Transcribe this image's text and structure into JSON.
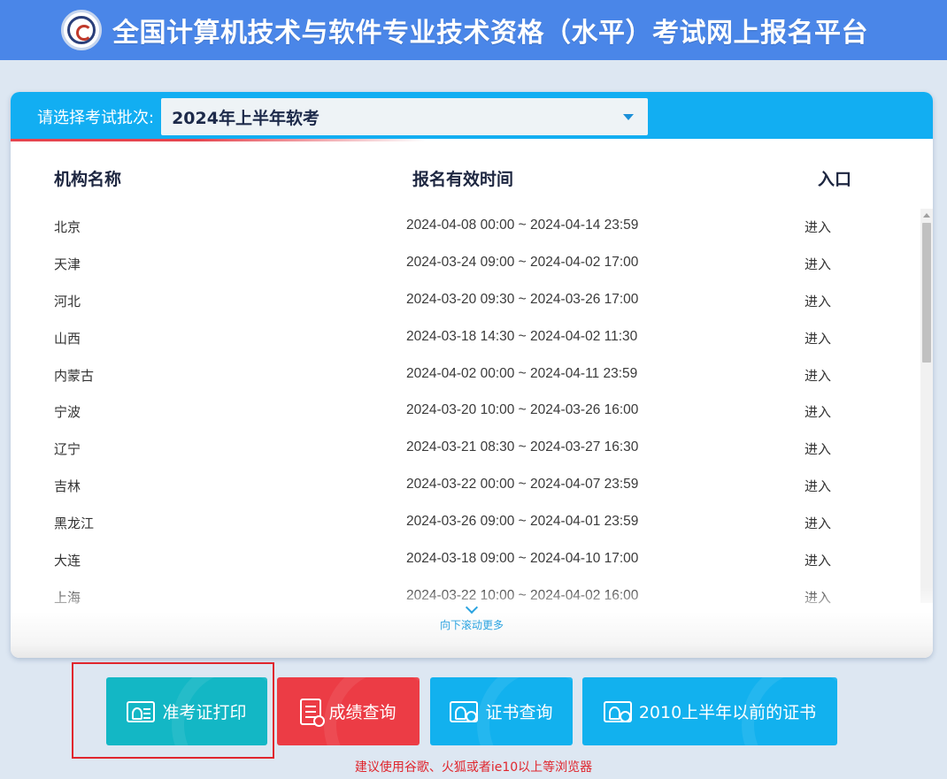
{
  "header": {
    "title": "全国计算机技术与软件专业技术资格（水平）考试网上报名平台"
  },
  "batch": {
    "label": "请选择考试批次:",
    "selected": "2024年上半年软考"
  },
  "table": {
    "columns": [
      "机构名称",
      "报名有效时间",
      "入口"
    ],
    "rows": [
      {
        "org": "北京",
        "time": "2024-04-08 00:00 ~ 2024-04-14 23:59",
        "entry": "进入"
      },
      {
        "org": "天津",
        "time": "2024-03-24 09:00 ~ 2024-04-02 17:00",
        "entry": "进入"
      },
      {
        "org": "河北",
        "time": "2024-03-20 09:30 ~ 2024-03-26 17:00",
        "entry": "进入"
      },
      {
        "org": "山西",
        "time": "2024-03-18 14:30 ~ 2024-04-02 11:30",
        "entry": "进入"
      },
      {
        "org": "内蒙古",
        "time": "2024-04-02 00:00 ~ 2024-04-11 23:59",
        "entry": "进入"
      },
      {
        "org": "宁波",
        "time": "2024-03-20 10:00 ~ 2024-03-26 16:00",
        "entry": "进入"
      },
      {
        "org": "辽宁",
        "time": "2024-03-21 08:30 ~ 2024-03-27 16:30",
        "entry": "进入"
      },
      {
        "org": "吉林",
        "time": "2024-03-22 00:00 ~ 2024-04-07 23:59",
        "entry": "进入"
      },
      {
        "org": "黑龙江",
        "time": "2024-03-26 09:00 ~ 2024-04-01 23:59",
        "entry": "进入"
      },
      {
        "org": "大连",
        "time": "2024-03-18 09:00 ~ 2024-04-10 17:00",
        "entry": "进入"
      },
      {
        "org": "上海",
        "time": "2024-03-22 10:00 ~ 2024-04-02 16:00",
        "entry": "进入"
      }
    ],
    "scroll_more": "向下滚动更多"
  },
  "actions": {
    "ticket_print": "准考证打印",
    "score_query": "成绩查询",
    "cert_query": "证书查询",
    "old_cert": "2010上半年以前的证书"
  },
  "note": "建议使用谷歌、火狐或者ie10以上等浏览器",
  "colors": {
    "header": "#4a86e8",
    "panel_head": "#12aef2",
    "ticket_button": "#13b7c5",
    "score_button": "#ec3c45",
    "cert_button": "#12b1ee",
    "highlight": "#e0262d"
  }
}
